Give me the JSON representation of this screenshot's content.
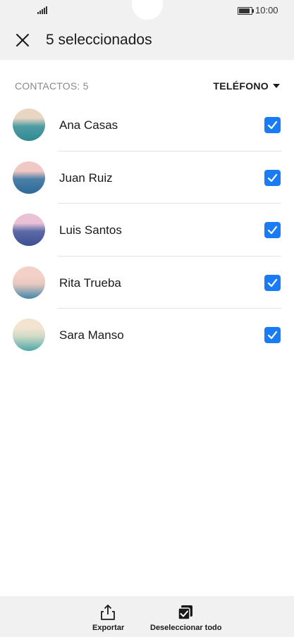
{
  "status_bar": {
    "time": "10:00"
  },
  "header": {
    "title": "5 seleccionados",
    "close_icon": "close-icon"
  },
  "list_header": {
    "count_label": "CONTACTOS: 5",
    "sort_label": "TELÉFONO"
  },
  "contacts": [
    {
      "name": "Ana Casas",
      "checked": true,
      "avatar_colors": [
        "#e8d6c2",
        "#4f9ca3",
        "#2f8a90"
      ]
    },
    {
      "name": "Juan Ruiz",
      "checked": true,
      "avatar_colors": [
        "#f1c9c4",
        "#4b7fa8",
        "#2e6a98"
      ]
    },
    {
      "name": "Luis Santos",
      "checked": true,
      "avatar_colors": [
        "#eac1d6",
        "#5b6aa8",
        "#3e4f92"
      ]
    },
    {
      "name": "Rita Trueba",
      "checked": true,
      "avatar_colors": [
        "#f4d1c8",
        "#e7c8bf",
        "#3f86a8"
      ]
    },
    {
      "name": "Sara Manso",
      "checked": true,
      "avatar_colors": [
        "#f2e4d0",
        "#cfd9c8",
        "#4ea7a8"
      ]
    }
  ],
  "bottom_bar": {
    "export_label": "Exportar",
    "deselect_label": "Deseleccionar todo"
  },
  "colors": {
    "accent": "#1a7cf5",
    "bar_background": "#f1f1f1"
  }
}
